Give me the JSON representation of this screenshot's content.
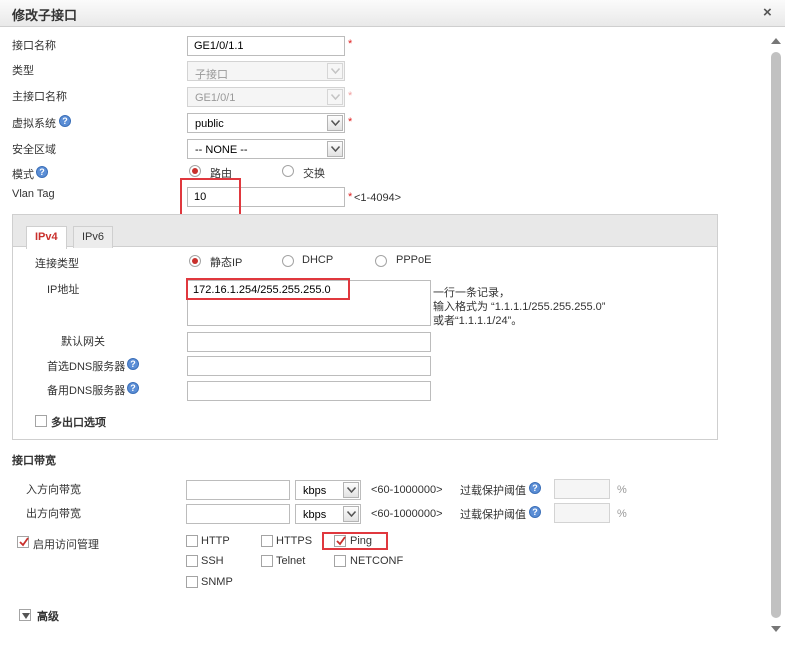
{
  "dialog": {
    "title": "修改子接口",
    "close_glyph": "×"
  },
  "form": {
    "interface_name": {
      "label": "接口名称",
      "value": "GE1/0/1.1"
    },
    "type": {
      "label": "类型",
      "value": "子接口"
    },
    "parent_interface": {
      "label": "主接口名称",
      "value": "GE1/0/1"
    },
    "virtual_system": {
      "label": "虚拟系统",
      "value": "public"
    },
    "security_zone": {
      "label": "安全区域",
      "value": "-- NONE --"
    },
    "mode": {
      "label": "模式",
      "option_route": "路由",
      "option_switch": "交换",
      "selected": "路由"
    },
    "vlan_tag": {
      "label": "Vlan Tag",
      "value": "10",
      "range_hint": "<1-4094>"
    },
    "required_mark": "*",
    "help_glyph": "?"
  },
  "tabs": [
    {
      "label": "IPv4",
      "active": true
    },
    {
      "label": "IPv6",
      "active": false
    }
  ],
  "ipv4": {
    "connection_type": {
      "label": "连接类型",
      "option_static": "静态IP",
      "option_dhcp": "DHCP",
      "option_pppoe": "PPPoE",
      "selected": "静态IP"
    },
    "ip_address": {
      "label": "IP地址",
      "value": "172.16.1.254/255.255.255.0"
    },
    "ip_hint": {
      "line1": "一行一条记录，",
      "line2": "输入格式为 “1.1.1.1/255.255.255.0”",
      "line3": "或者“1.1.1.1/24”。"
    },
    "default_gateway": {
      "label": "默认网关",
      "value": ""
    },
    "primary_dns": {
      "label": "首选DNS服务器",
      "value": ""
    },
    "secondary_dns": {
      "label": "备用DNS服务器",
      "value": ""
    },
    "multi_egress": {
      "label": "多出口选项",
      "checked": false
    }
  },
  "bandwidth": {
    "section_title": "接口带宽",
    "inbound": {
      "label": "入方向带宽",
      "value": "",
      "unit": "kbps",
      "range": "<60-1000000>",
      "protect_label": "过载保护阈值",
      "percent_unit": "%"
    },
    "outbound": {
      "label": "出方向带宽",
      "value": "",
      "unit": "kbps",
      "range": "<60-1000000>",
      "protect_label": "过载保护阈值",
      "percent_unit": "%"
    }
  },
  "access_mgmt": {
    "label": "启用访问管理",
    "checked": true,
    "services": {
      "http": {
        "label": "HTTP",
        "checked": false
      },
      "https": {
        "label": "HTTPS",
        "checked": false
      },
      "ping": {
        "label": "Ping",
        "checked": true
      },
      "ssh": {
        "label": "SSH",
        "checked": false
      },
      "telnet": {
        "label": "Telnet",
        "checked": false
      },
      "netconf": {
        "label": "NETCONF",
        "checked": false
      },
      "snmp": {
        "label": "SNMP",
        "checked": false
      }
    }
  },
  "advanced": {
    "label": "高级"
  },
  "colors": {
    "accent_red": "#c9302c",
    "highlight_box": "#e0383e",
    "help_blue": "#5b8ed6"
  }
}
